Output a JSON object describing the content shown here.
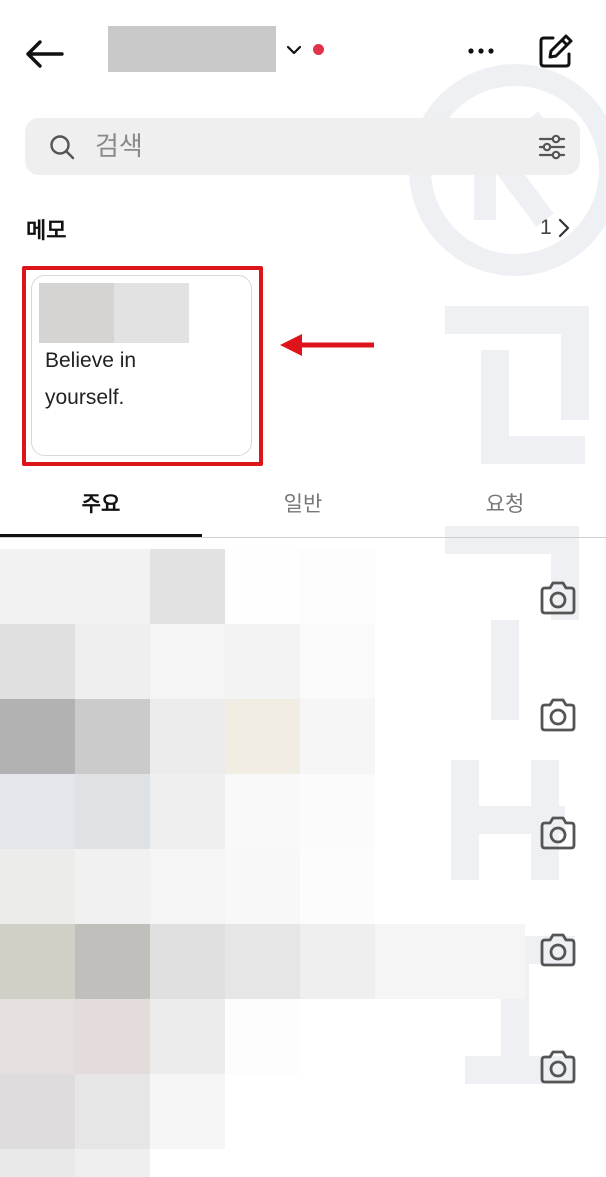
{
  "header": {
    "back_icon": "arrow-left-icon",
    "dropdown_icon": "chevron-down-icon",
    "more_icon": "more-horizontal-icon",
    "compose_icon": "compose-edit-icon",
    "notification_dot_color": "#e0334a"
  },
  "search": {
    "placeholder": "검색",
    "value": "",
    "icon": "search-icon",
    "filter_icon": "filter-sliders-icon"
  },
  "memo": {
    "section_title": "메모",
    "count": "1",
    "card_text_line1": "Believe in",
    "card_text_line2": "yourself.",
    "highlight_color": "#dd1419"
  },
  "tabs": [
    {
      "label": "주요",
      "active": true
    },
    {
      "label": "일반",
      "active": false
    },
    {
      "label": "요청",
      "active": false
    }
  ],
  "conversations": {
    "camera_icon": "camera-icon",
    "row_count": 5
  }
}
